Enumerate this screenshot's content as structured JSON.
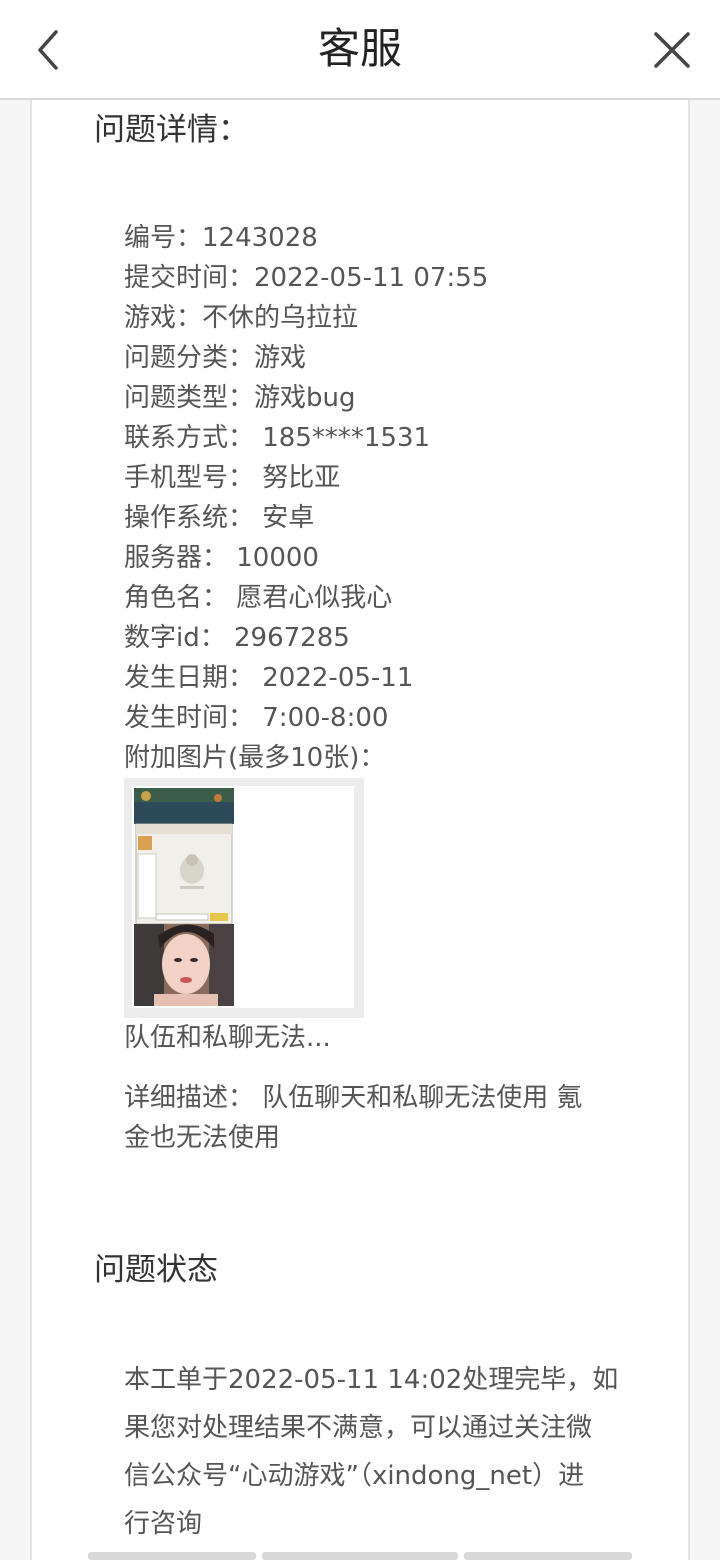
{
  "header": {
    "title": "客服"
  },
  "details": {
    "section_title": "问题详情：",
    "rows": [
      "编号：1243028",
      "提交时间：2022-05-11 07:55",
      "游戏：不休的乌拉拉",
      "问题分类：游戏",
      "问题类型：游戏bug",
      "联系方式： 185****1531",
      "手机型号： 努比亚",
      "操作系统： 安卓",
      "服务器： 10000",
      "角色名： 愿君心似我心",
      "数字id： 2967285",
      "发生日期： 2022-05-11",
      "发生时间： 7:00-8:00",
      "附加图片(最多10张)："
    ],
    "image_caption": "队伍和私聊无法...",
    "description_line1": "详细描述： 队伍聊天和私聊无法使用 氪",
    "description_line2": "金也无法使用"
  },
  "status": {
    "section_title": "问题状态",
    "line1": "本工单于2022-05-11 14:02处理完毕，如",
    "line2": "果您对处理结果不满意，可以通过关注微",
    "line3": "信公众号“心动游戏”（xindong_net）进",
    "line4": "行咨询"
  },
  "icons": {
    "back": "chevron-left-icon",
    "close": "close-icon"
  }
}
